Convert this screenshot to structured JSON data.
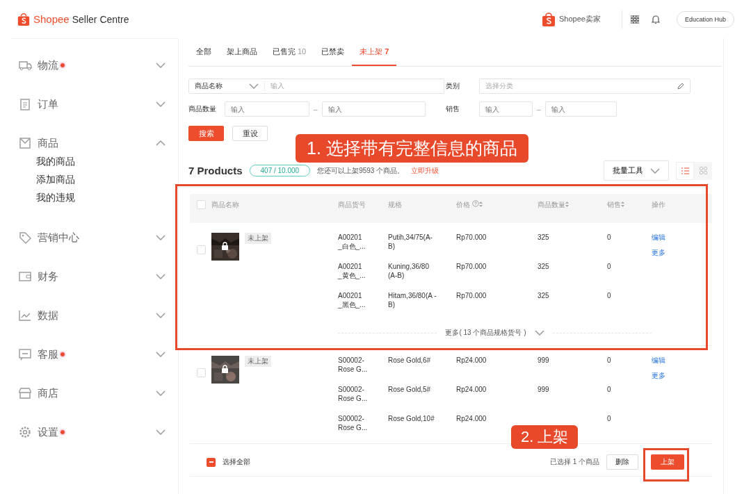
{
  "header": {
    "brand": "Shopee",
    "product": "Seller Centre",
    "center_logo": "Shopee卖家",
    "help_button": "Education Hub"
  },
  "sidebar": {
    "items": [
      {
        "label": "物流",
        "dot": true,
        "expanded": false
      },
      {
        "label": "订单",
        "dot": false,
        "expanded": false
      },
      {
        "label": "商品",
        "dot": false,
        "expanded": true,
        "children": [
          {
            "label": "我的商品"
          },
          {
            "label": "添加商品"
          },
          {
            "label": "我的违规"
          }
        ]
      },
      {
        "label": "营销中心",
        "dot": false,
        "expanded": false
      },
      {
        "label": "财务",
        "dot": false,
        "expanded": false
      },
      {
        "label": "数据",
        "dot": false,
        "expanded": false
      },
      {
        "label": "客服",
        "dot": true,
        "expanded": false
      },
      {
        "label": "商店",
        "dot": false,
        "expanded": false
      },
      {
        "label": "设置",
        "dot": true,
        "expanded": false
      }
    ]
  },
  "tabs": [
    {
      "label": "全部",
      "selected": false
    },
    {
      "label": "架上商品",
      "selected": false
    },
    {
      "label": "已售完",
      "count": "10",
      "selected": false
    },
    {
      "label": "已禁卖",
      "selected": false
    },
    {
      "label": "未上架",
      "count": "7",
      "selected": true
    }
  ],
  "filters": {
    "name_select": "商品名称",
    "name_placeholder": "输入",
    "category_label": "类别",
    "category_placeholder": "选择分类",
    "qty_label": "商品数量",
    "qty_min_placeholder": "输入",
    "qty_max_placeholder": "输入",
    "sales_label": "销售",
    "sales_min_placeholder": "输入",
    "sales_max_placeholder": "输入",
    "range_sep": "–",
    "search_button": "搜索",
    "reset_button": "重设"
  },
  "summary": {
    "title": "7 Products",
    "quota": "407 / 10.000",
    "note": "您还可以上架9593 个商品。",
    "upgrade_link": "立即升级",
    "bulk_button": "批量工具",
    "views": [
      {
        "selected": true
      },
      {
        "selected": false
      }
    ]
  },
  "table": {
    "header_checked": false,
    "columns": [
      "商品名称",
      "商品货号",
      "规格",
      "价格",
      "商品数量",
      "销售",
      "操作"
    ],
    "products": [
      {
        "checked": false,
        "status": "未上架",
        "variants": [
          {
            "sku": "A00201\n_白色_...",
            "spec": "Putih,34/75(A-B)",
            "price": "Rp70.000",
            "qty": "325",
            "sales": "0"
          },
          {
            "sku": "A00201\n_黄色_...",
            "spec": "Kuning,36/80 (A-B)",
            "price": "Rp70.000",
            "qty": "325",
            "sales": "0"
          },
          {
            "sku": "A00201\n_黑色_...",
            "spec": "Hitam,36/80(A -B)",
            "price": "Rp70.000",
            "qty": "325",
            "sales": "0"
          }
        ],
        "actions": [
          "编辑",
          "更多"
        ],
        "more": "更多( 13 个商品规格货号 )"
      },
      {
        "checked": false,
        "status": "未上架",
        "variants": [
          {
            "sku": "S00002-\nRose G...",
            "spec": "Rose Gold,6#",
            "price": "Rp24.000",
            "qty": "999",
            "sales": "0"
          },
          {
            "sku": "S00002-\nRose G...",
            "spec": "Rose Gold,5#",
            "price": "Rp24.000",
            "qty": "999",
            "sales": "0"
          },
          {
            "sku": "S00002-\nRose G...",
            "spec": "Rose Gold,10#",
            "price": "Rp24.000",
            "sales": "0"
          }
        ],
        "actions": [
          "编辑",
          "更多"
        ]
      }
    ]
  },
  "footer": {
    "select_all": {
      "label": "选择全部",
      "checked": true
    },
    "selected_text": "已选择 1 个商品",
    "delete_button": "删除",
    "publish_button": "上架"
  },
  "annotations": [
    {
      "text": "1. 选择带有完整信息的商品"
    },
    {
      "text": "2. 上架"
    }
  ]
}
